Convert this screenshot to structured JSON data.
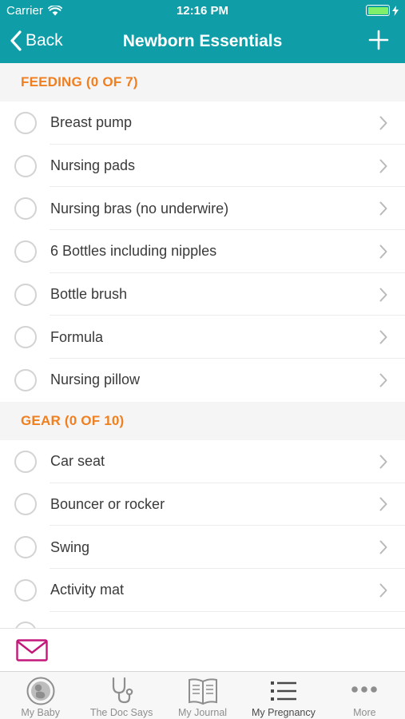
{
  "status_bar": {
    "carrier": "Carrier",
    "time": "12:16 PM"
  },
  "nav": {
    "back_label": "Back",
    "title": "Newborn Essentials",
    "add_icon": "plus-icon"
  },
  "sections": [
    {
      "header": "FEEDING (0 OF 7)",
      "items": [
        {
          "label": "Breast pump",
          "checked": false
        },
        {
          "label": "Nursing pads",
          "checked": false
        },
        {
          "label": "Nursing bras (no underwire)",
          "checked": false
        },
        {
          "label": "6 Bottles including nipples",
          "checked": false
        },
        {
          "label": "Bottle brush",
          "checked": false
        },
        {
          "label": "Formula",
          "checked": false
        },
        {
          "label": "Nursing pillow",
          "checked": false
        }
      ]
    },
    {
      "header": "GEAR (0 OF 10)",
      "items": [
        {
          "label": "Car seat",
          "checked": false
        },
        {
          "label": "Bouncer or rocker",
          "checked": false
        },
        {
          "label": "Swing",
          "checked": false
        },
        {
          "label": "Activity mat",
          "checked": false
        },
        {
          "label": "",
          "checked": false
        }
      ]
    }
  ],
  "mail": {
    "icon": "envelope-icon"
  },
  "tabs": [
    {
      "label": "My Baby",
      "icon": "baby-icon",
      "active": false
    },
    {
      "label": "The Doc Says",
      "icon": "stethoscope-icon",
      "active": false
    },
    {
      "label": "My Journal",
      "icon": "journal-icon",
      "active": false
    },
    {
      "label": "My Pregnancy",
      "icon": "list-icon",
      "active": true
    },
    {
      "label": "More",
      "icon": "more-icon",
      "active": false
    }
  ],
  "colors": {
    "header_bg": "#0f9ea8",
    "section_header_text": "#f07f1f",
    "mail_icon": "#c4177a",
    "battery": "#7ef06a"
  }
}
